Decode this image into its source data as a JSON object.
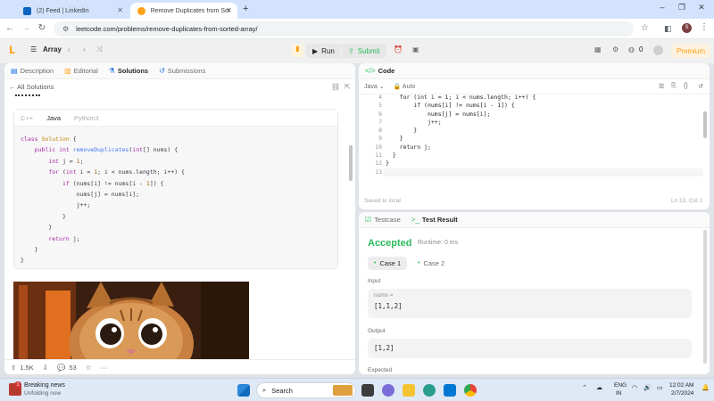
{
  "browser": {
    "tabs": [
      {
        "label": "(2) Feed | LinkedIn",
        "favicon": "linkedin-icon",
        "active": false
      },
      {
        "label": "Remove Duplicates from Sorte",
        "favicon": "leetcode-icon",
        "active": true
      }
    ],
    "new_tab": "+",
    "url": "leetcode.com/problems/remove-duplicates-from-sorted-array/",
    "profile_initial": "S"
  },
  "leetcode_nav": {
    "problem_list_label": "Array",
    "run_label": "Run",
    "submit_label": "Submit",
    "coins": "0",
    "premium_label": "Premium"
  },
  "left_panel": {
    "tabs": [
      "Description",
      "Editorial",
      "Solutions",
      "Submissions"
    ],
    "active_tab": "Solutions",
    "back_link": "All Solutions",
    "lang_tabs": [
      "C++",
      "Java",
      "Python3"
    ],
    "active_lang": "Java",
    "footer": {
      "upvotes": "1.5K",
      "comments": "53"
    }
  },
  "editor": {
    "title": "Code",
    "language": "Java",
    "mode": "Auto",
    "line_numbers": [
      "4",
      "5",
      "6",
      "7",
      "8",
      "9",
      "10",
      "11",
      "12",
      "13"
    ],
    "status": "Saved to local",
    "cursor": "Ln 13, Col 1"
  },
  "result": {
    "tabs": [
      "Testcase",
      "Test Result"
    ],
    "active_tab": "Test Result",
    "verdict": "Accepted",
    "runtime": "Runtime: 0 ms",
    "cases": [
      "Case 1",
      "Case 2"
    ],
    "input_label": "Input",
    "input_var": "nums =",
    "input_value": "[1,1,2]",
    "output_label": "Output",
    "output_value": "[1,2]",
    "expected_label": "Expected"
  },
  "taskbar": {
    "news_title": "Breaking news",
    "news_sub": "Unfolding now",
    "news_badge": "1",
    "search_placeholder": "Search",
    "lang_top": "ENG",
    "lang_bottom": "IN",
    "time": "12:02 AM",
    "date": "2/7/2024"
  },
  "colors": {
    "accent_green": "#2cbb5d",
    "leetcode_orange": "#ffa116",
    "link_blue": "#1a73e8"
  }
}
